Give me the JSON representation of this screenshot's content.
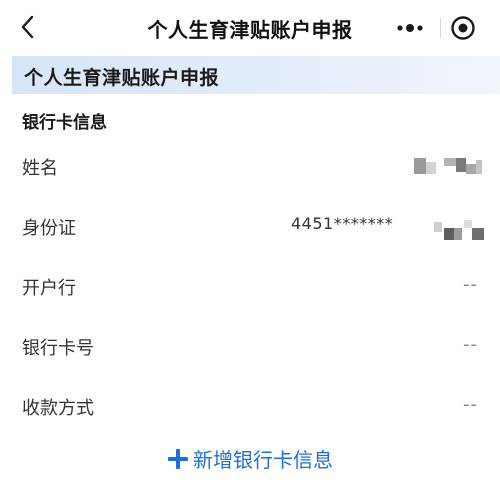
{
  "navbar": {
    "title": "个人生育津贴账户申报"
  },
  "banner": {
    "title": "个人生育津贴账户申报"
  },
  "section": {
    "title": "银行卡信息"
  },
  "rows": [
    {
      "label": "姓名",
      "value": ""
    },
    {
      "label": "身份证",
      "value": "4451*******"
    },
    {
      "label": "开户行",
      "value": "--"
    },
    {
      "label": "银行卡号",
      "value": "--"
    },
    {
      "label": "收款方式",
      "value": "--"
    }
  ],
  "add_link": {
    "label": "新增银行卡信息"
  },
  "colors": {
    "accent": "#1e6fd9",
    "banner_bg": "#dde9f8",
    "text": "#222222"
  }
}
